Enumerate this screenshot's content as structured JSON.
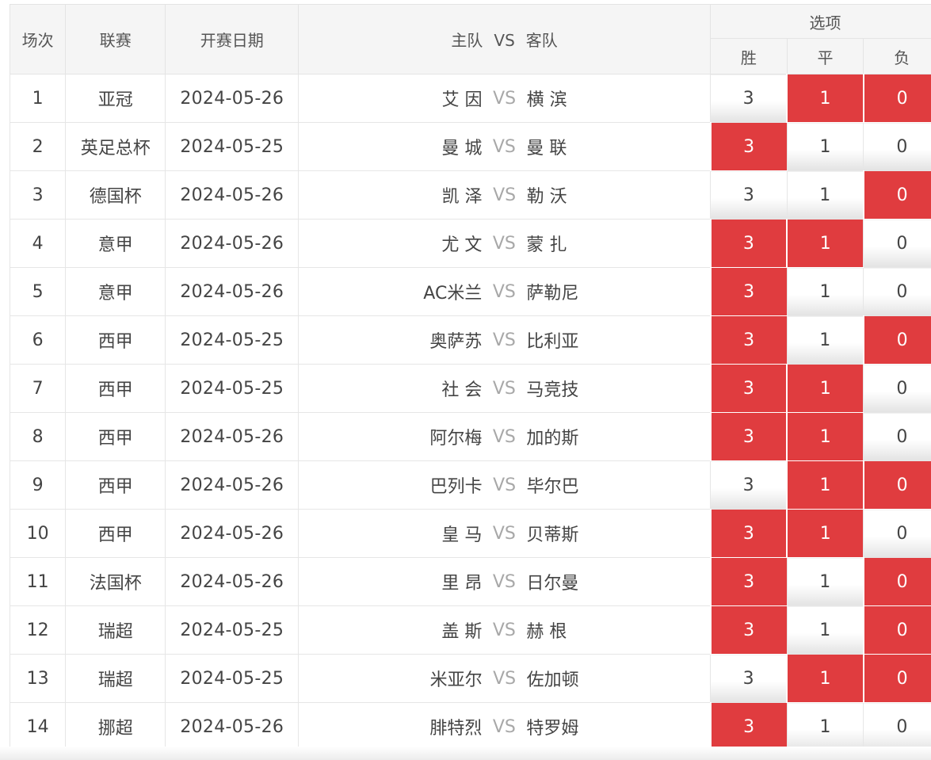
{
  "headers": {
    "num": "场次",
    "league": "联赛",
    "date": "开赛日期",
    "home": "主队",
    "vs": "VS",
    "away": "客队",
    "options": "选项",
    "win": "胜",
    "draw": "平",
    "lose": "负"
  },
  "colors": {
    "selected": "#e03c3f",
    "header_bg": "#f5f5f5"
  },
  "rows": [
    {
      "num": "1",
      "league": "亚冠",
      "date": "2024-05-26",
      "home": "艾 因",
      "vs": "VS",
      "away": "横 滨",
      "win": "3",
      "draw": "1",
      "lose": "0",
      "sel": [
        false,
        true,
        true
      ]
    },
    {
      "num": "2",
      "league": "英足总杯",
      "date": "2024-05-25",
      "home": "曼 城",
      "vs": "VS",
      "away": "曼 联",
      "win": "3",
      "draw": "1",
      "lose": "0",
      "sel": [
        true,
        false,
        false
      ]
    },
    {
      "num": "3",
      "league": "德国杯",
      "date": "2024-05-26",
      "home": "凯 泽",
      "vs": "VS",
      "away": "勒 沃",
      "win": "3",
      "draw": "1",
      "lose": "0",
      "sel": [
        false,
        false,
        true
      ]
    },
    {
      "num": "4",
      "league": "意甲",
      "date": "2024-05-26",
      "home": "尤 文",
      "vs": "VS",
      "away": "蒙 扎",
      "win": "3",
      "draw": "1",
      "lose": "0",
      "sel": [
        true,
        true,
        false
      ]
    },
    {
      "num": "5",
      "league": "意甲",
      "date": "2024-05-26",
      "home": "AC米兰",
      "vs": "VS",
      "away": "萨勒尼",
      "win": "3",
      "draw": "1",
      "lose": "0",
      "sel": [
        true,
        false,
        false
      ]
    },
    {
      "num": "6",
      "league": "西甲",
      "date": "2024-05-25",
      "home": "奥萨苏",
      "vs": "VS",
      "away": "比利亚",
      "win": "3",
      "draw": "1",
      "lose": "0",
      "sel": [
        true,
        false,
        true
      ]
    },
    {
      "num": "7",
      "league": "西甲",
      "date": "2024-05-25",
      "home": "社 会",
      "vs": "VS",
      "away": "马竞技",
      "win": "3",
      "draw": "1",
      "lose": "0",
      "sel": [
        true,
        true,
        false
      ]
    },
    {
      "num": "8",
      "league": "西甲",
      "date": "2024-05-26",
      "home": "阿尔梅",
      "vs": "VS",
      "away": "加的斯",
      "win": "3",
      "draw": "1",
      "lose": "0",
      "sel": [
        true,
        true,
        false
      ]
    },
    {
      "num": "9",
      "league": "西甲",
      "date": "2024-05-26",
      "home": "巴列卡",
      "vs": "VS",
      "away": "毕尔巴",
      "win": "3",
      "draw": "1",
      "lose": "0",
      "sel": [
        false,
        true,
        true
      ]
    },
    {
      "num": "10",
      "league": "西甲",
      "date": "2024-05-26",
      "home": "皇 马",
      "vs": "VS",
      "away": "贝蒂斯",
      "win": "3",
      "draw": "1",
      "lose": "0",
      "sel": [
        true,
        true,
        false
      ]
    },
    {
      "num": "11",
      "league": "法国杯",
      "date": "2024-05-26",
      "home": "里 昂",
      "vs": "VS",
      "away": "日尔曼",
      "win": "3",
      "draw": "1",
      "lose": "0",
      "sel": [
        true,
        false,
        true
      ]
    },
    {
      "num": "12",
      "league": "瑞超",
      "date": "2024-05-25",
      "home": "盖 斯",
      "vs": "VS",
      "away": "赫 根",
      "win": "3",
      "draw": "1",
      "lose": "0",
      "sel": [
        true,
        false,
        true
      ]
    },
    {
      "num": "13",
      "league": "瑞超",
      "date": "2024-05-25",
      "home": "米亚尔",
      "vs": "VS",
      "away": "佐加顿",
      "win": "3",
      "draw": "1",
      "lose": "0",
      "sel": [
        false,
        true,
        true
      ]
    },
    {
      "num": "14",
      "league": "挪超",
      "date": "2024-05-26",
      "home": "腓特烈",
      "vs": "VS",
      "away": "特罗姆",
      "win": "3",
      "draw": "1",
      "lose": "0",
      "sel": [
        true,
        false,
        false
      ]
    }
  ]
}
